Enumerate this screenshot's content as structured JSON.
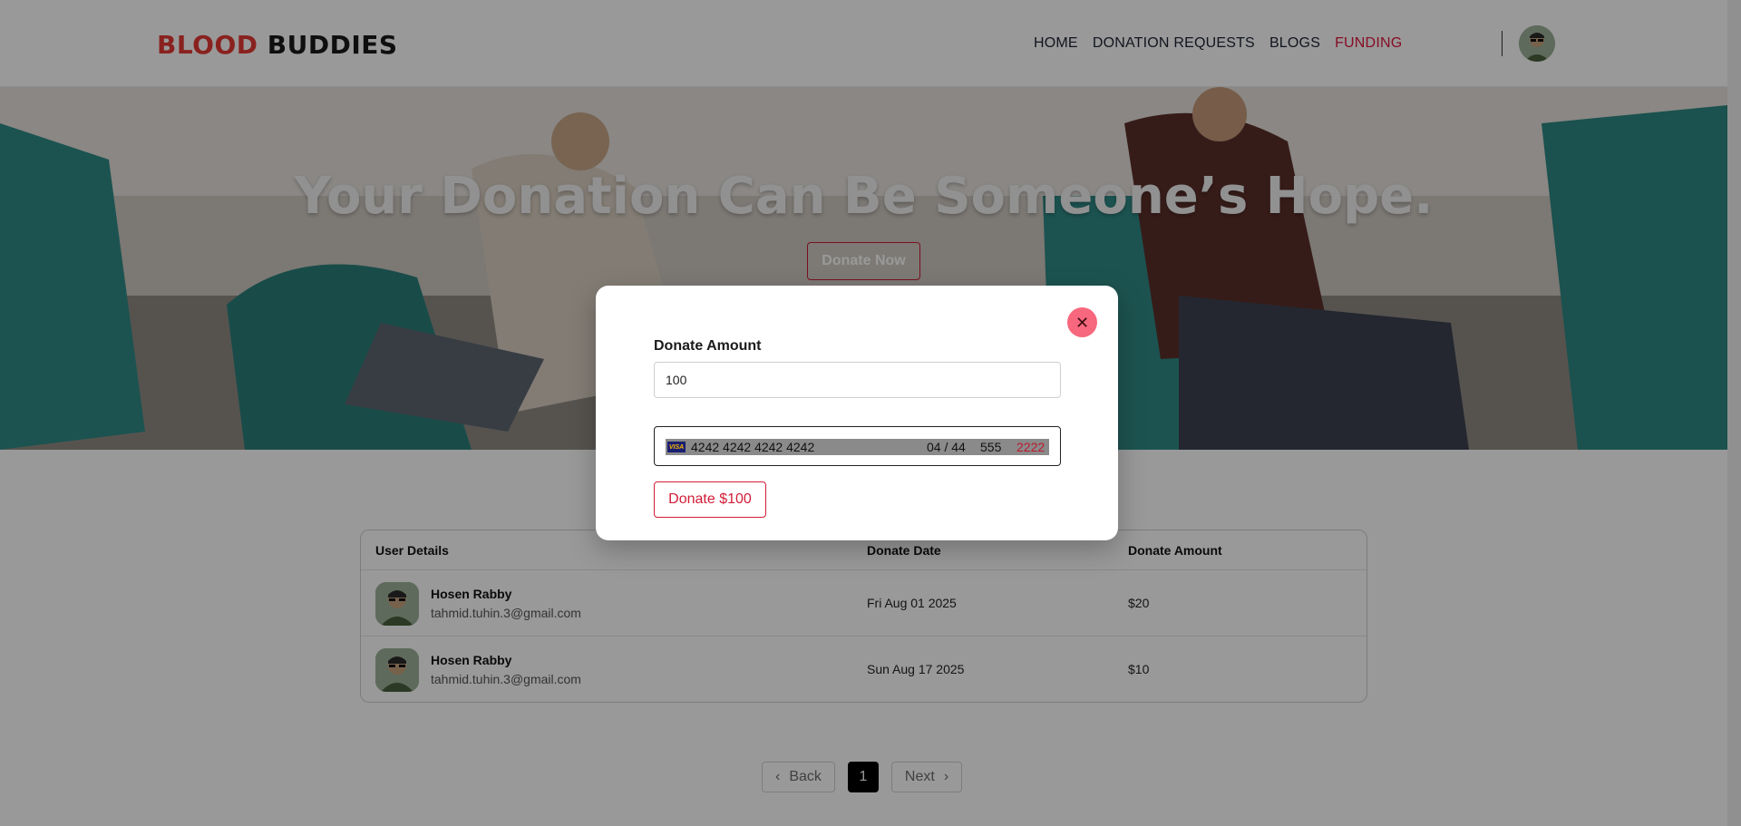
{
  "brand": {
    "part1": "BLOOD",
    "part2": "BUDDIES"
  },
  "nav": {
    "items": [
      {
        "label": "HOME"
      },
      {
        "label": "DONATION REQUESTS"
      },
      {
        "label": "BLOGS"
      },
      {
        "label": "FUNDING",
        "active": true
      }
    ]
  },
  "hero": {
    "title": "Your Donation Can Be Someone’s Hope.",
    "button_label": "Donate Now"
  },
  "table": {
    "headers": [
      "User Details",
      "Donate Date",
      "Donate Amount"
    ],
    "rows": [
      {
        "name": "Hosen Rabby",
        "email": "tahmid.tuhin.3@gmail.com",
        "date": "Fri Aug 01 2025",
        "amount": "$20"
      },
      {
        "name": "Hosen Rabby",
        "email": "tahmid.tuhin.3@gmail.com",
        "date": "Sun Aug 17 2025",
        "amount": "$10"
      }
    ]
  },
  "pagination": {
    "back_label": "Back",
    "current_page": "1",
    "next_label": "Next"
  },
  "modal": {
    "close_symbol": "✕",
    "amount_label": "Donate Amount",
    "amount_value": "100",
    "card": {
      "brand": "VISA",
      "number": "4242 4242 4242 4242",
      "expiry": "04 / 44",
      "cvc": "555",
      "zip": "2222"
    },
    "submit_label": "Donate $100"
  },
  "colors": {
    "accent": "#e0143c",
    "logo_red": "#e53935",
    "close_button": "#f7677d"
  }
}
